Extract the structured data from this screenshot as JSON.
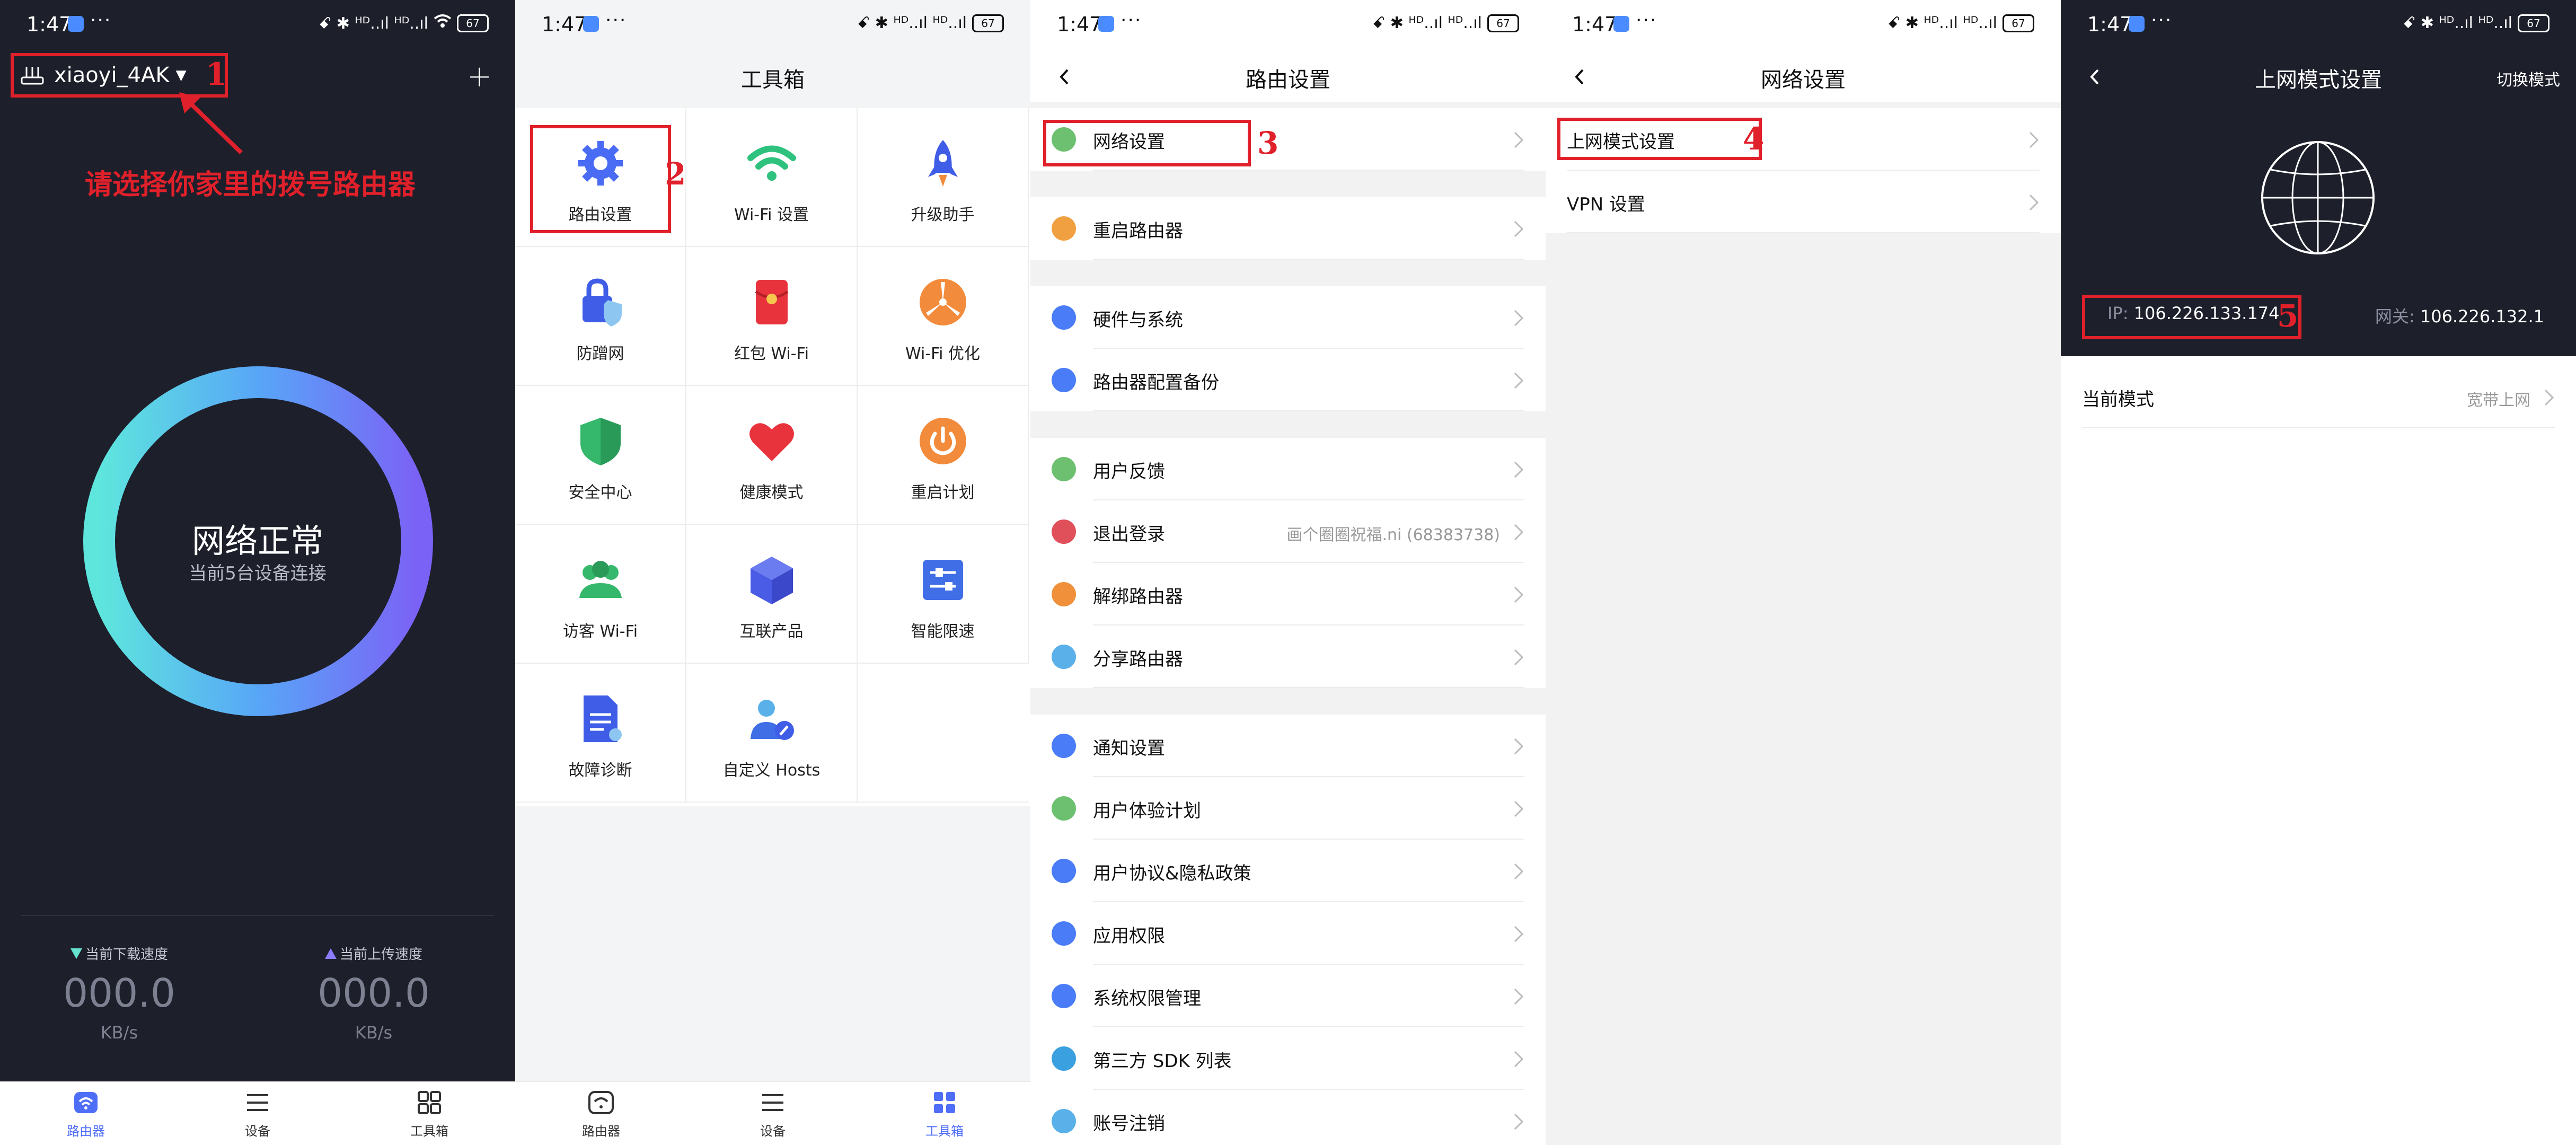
{
  "status_bar": {
    "time": "1:47",
    "more": "···",
    "signal_text": "ꗃ ✱ ᴴᴰ..ıl ᴴᴰ..ıl",
    "battery": "67"
  },
  "panel1": {
    "router_name": "xiaoyi_4AK",
    "hint": "请选择你家里的拨号路由器",
    "status_title": "网络正常",
    "status_sub": "当前5台设备连接",
    "download_label": "当前下载速度",
    "upload_label": "当前上传速度",
    "download_value": "000.0",
    "upload_value": "000.0",
    "unit": "KB/s",
    "callout": "1"
  },
  "nav": {
    "router": "路由器",
    "devices": "设备",
    "toolbox": "工具箱"
  },
  "panel2": {
    "title": "工具箱",
    "callout": "2",
    "tools": [
      {
        "label": "路由设置",
        "icon": "gear-icon"
      },
      {
        "label": "Wi-Fi 设置",
        "icon": "wifi-icon"
      },
      {
        "label": "升级助手",
        "icon": "rocket-icon"
      },
      {
        "label": "防蹭网",
        "icon": "lock-shield-icon"
      },
      {
        "label": "红包 Wi-Fi",
        "icon": "red-envelope-icon"
      },
      {
        "label": "Wi-Fi 优化",
        "icon": "fan-icon"
      },
      {
        "label": "安全中心",
        "icon": "shield-icon"
      },
      {
        "label": "健康模式",
        "icon": "heart-icon"
      },
      {
        "label": "重启计划",
        "icon": "power-icon"
      },
      {
        "label": "访客 Wi-Fi",
        "icon": "guests-icon"
      },
      {
        "label": "互联产品",
        "icon": "cube-icon"
      },
      {
        "label": "智能限速",
        "icon": "sliders-icon"
      },
      {
        "label": "故障诊断",
        "icon": "document-icon"
      },
      {
        "label": "自定义 Hosts",
        "icon": "user-edit-icon"
      }
    ]
  },
  "panel3": {
    "title": "路由设置",
    "callout": "3",
    "rows": [
      {
        "label": "网络设置",
        "color": "#6cc070",
        "value": ""
      },
      {
        "label": "重启路由器",
        "color": "#f0a040",
        "value": ""
      },
      {
        "label": "硬件与系统",
        "color": "#4a7cf7",
        "value": ""
      },
      {
        "label": "路由器配置备份",
        "color": "#4a7cf7",
        "value": ""
      },
      {
        "label": "用户反馈",
        "color": "#6cc070",
        "value": ""
      },
      {
        "label": "退出登录",
        "color": "#e0505a",
        "value": "画个圈圈祝福.ni (68383738)"
      },
      {
        "label": "解绑路由器",
        "color": "#f0903a",
        "value": ""
      },
      {
        "label": "分享路由器",
        "color": "#5ab0e8",
        "value": ""
      },
      {
        "label": "通知设置",
        "color": "#4a7cf7",
        "value": ""
      },
      {
        "label": "用户体验计划",
        "color": "#6cc070",
        "value": ""
      },
      {
        "label": "用户协议&隐私政策",
        "color": "#4a7cf7",
        "value": ""
      },
      {
        "label": "应用权限",
        "color": "#4a7cf7",
        "value": ""
      },
      {
        "label": "系统权限管理",
        "color": "#4a7cf7",
        "value": ""
      },
      {
        "label": "第三方 SDK 列表",
        "color": "#3aa0e0",
        "value": ""
      },
      {
        "label": "账号注销",
        "color": "#5ab0e8",
        "value": ""
      }
    ]
  },
  "panel4": {
    "title": "网络设置",
    "callout": "4",
    "rows": [
      {
        "label": "上网模式设置"
      },
      {
        "label": "VPN 设置"
      }
    ]
  },
  "panel5": {
    "title": "上网模式设置",
    "switch_mode": "切换模式",
    "ip_label": "IP:",
    "ip_value": "106.226.133.174",
    "gw_label": "网关:",
    "gw_value": "106.226.132.1",
    "mode_label": "当前模式",
    "mode_value": "宽带上网",
    "callout": "5"
  },
  "colors": {
    "accent": "#4f6ef7",
    "callout_red": "#e0202a",
    "dark_bg": "#1d1f2b"
  }
}
